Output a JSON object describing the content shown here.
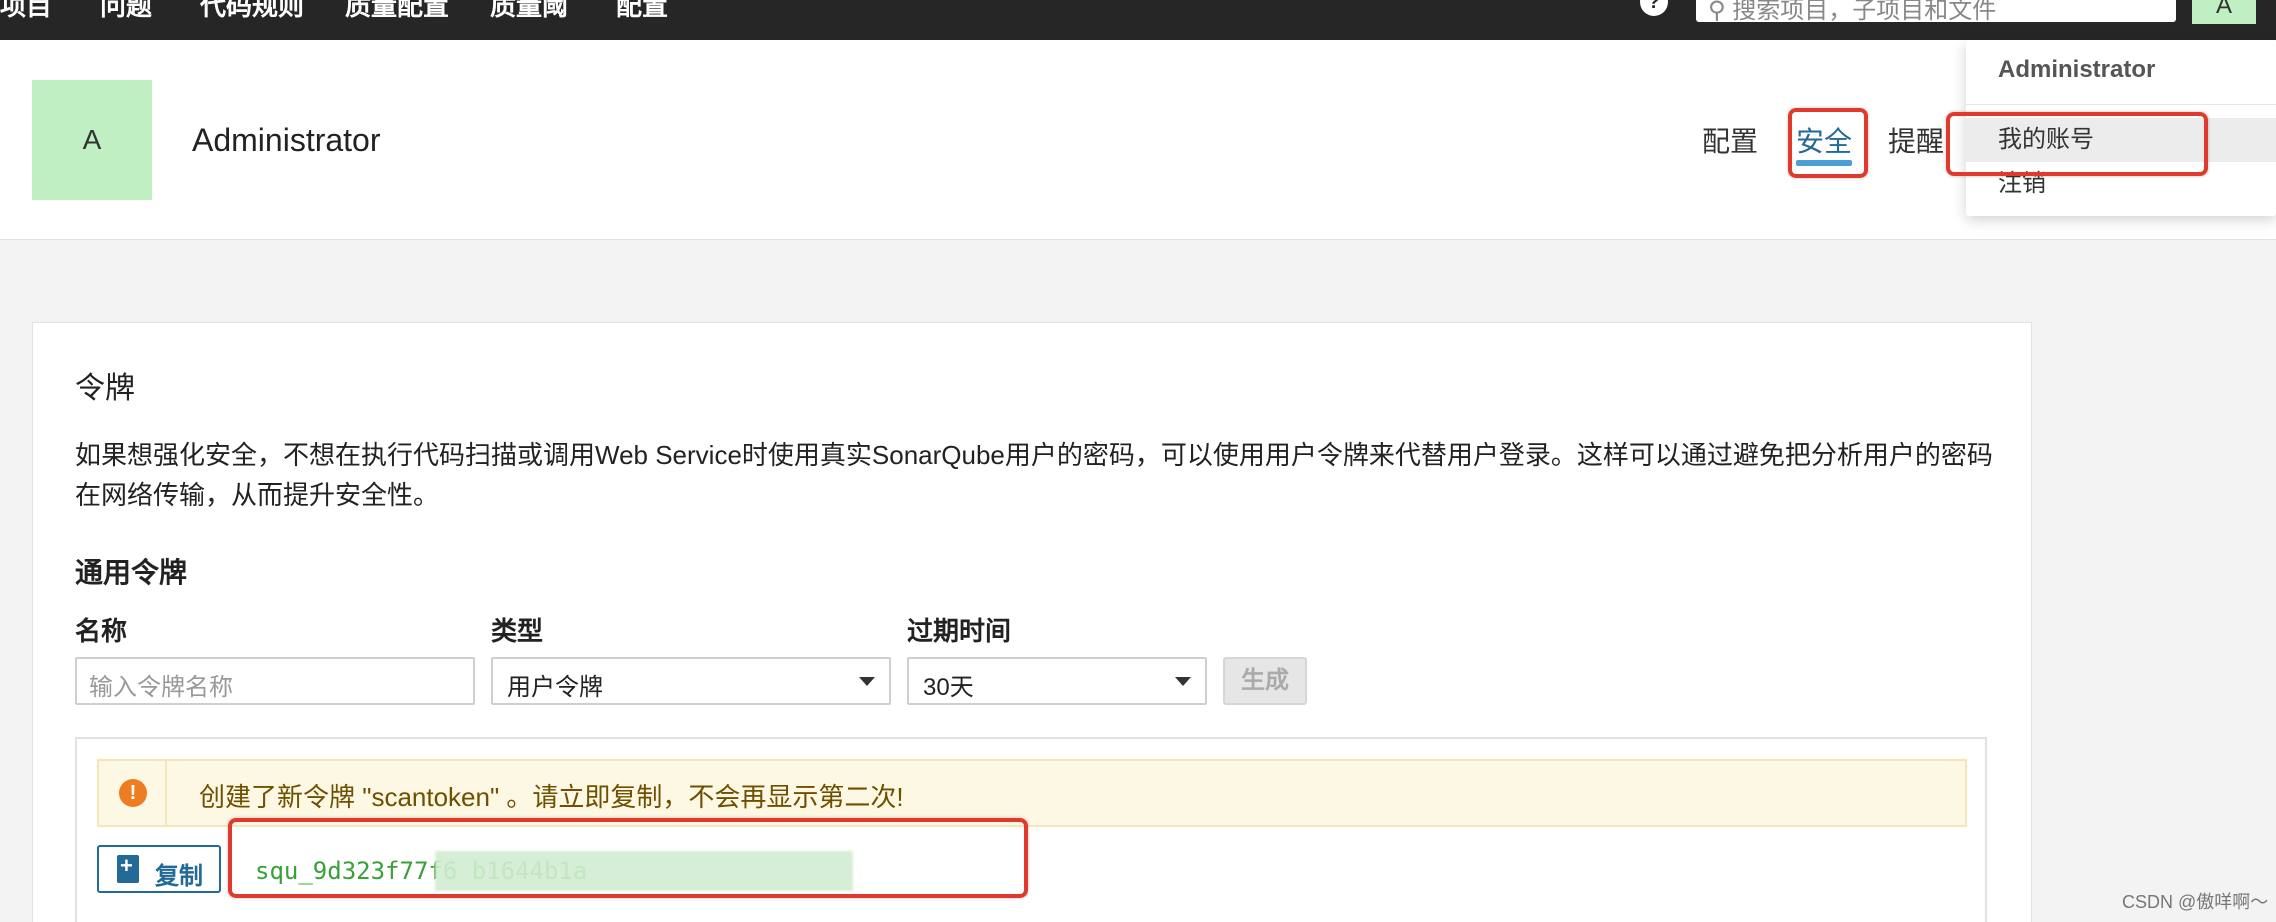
{
  "topnav": {
    "items": [
      "项目",
      "问题",
      "代码规则",
      "质量配置",
      "质量阈",
      "配置"
    ],
    "search_placeholder": "搜索项目，子项目和文件",
    "help_icon": "?",
    "avatar_letter": "A"
  },
  "account": {
    "avatar_letter": "A",
    "name": "Administrator",
    "tabs": [
      "配置",
      "安全",
      "提醒"
    ],
    "active_tab": "安全"
  },
  "dropdown": {
    "title": "Administrator",
    "items": [
      "我的账号",
      "注销"
    ]
  },
  "tokens": {
    "title": "令牌",
    "description": "如果想强化安全，不想在执行代码扫描或调用Web Service时使用真实SonarQube用户的密码，可以使用用户令牌来代替用户登录。这样可以通过避免把分析用户的密码在网络传输，从而提升安全性。",
    "section_title": "通用令牌",
    "name_label": "名称",
    "name_placeholder": "输入令牌名称",
    "type_label": "类型",
    "type_value": "用户令牌",
    "expiry_label": "过期时间",
    "expiry_value": "30天",
    "generate_label": "生成",
    "alert_text": "创建了新令牌 \"scantoken\" 。请立即复制，不会再显示第二次!",
    "copy_label": "复制",
    "token_value": "squ_9d323f77f6                       b1644b1a"
  },
  "watermark": "CSDN @傲咩啊～",
  "colors": {
    "highlight_red": "#e03a2f",
    "active_tab_blue": "#4b9fd5",
    "avatar_green": "#bfefc3",
    "token_green": "#38a138"
  }
}
